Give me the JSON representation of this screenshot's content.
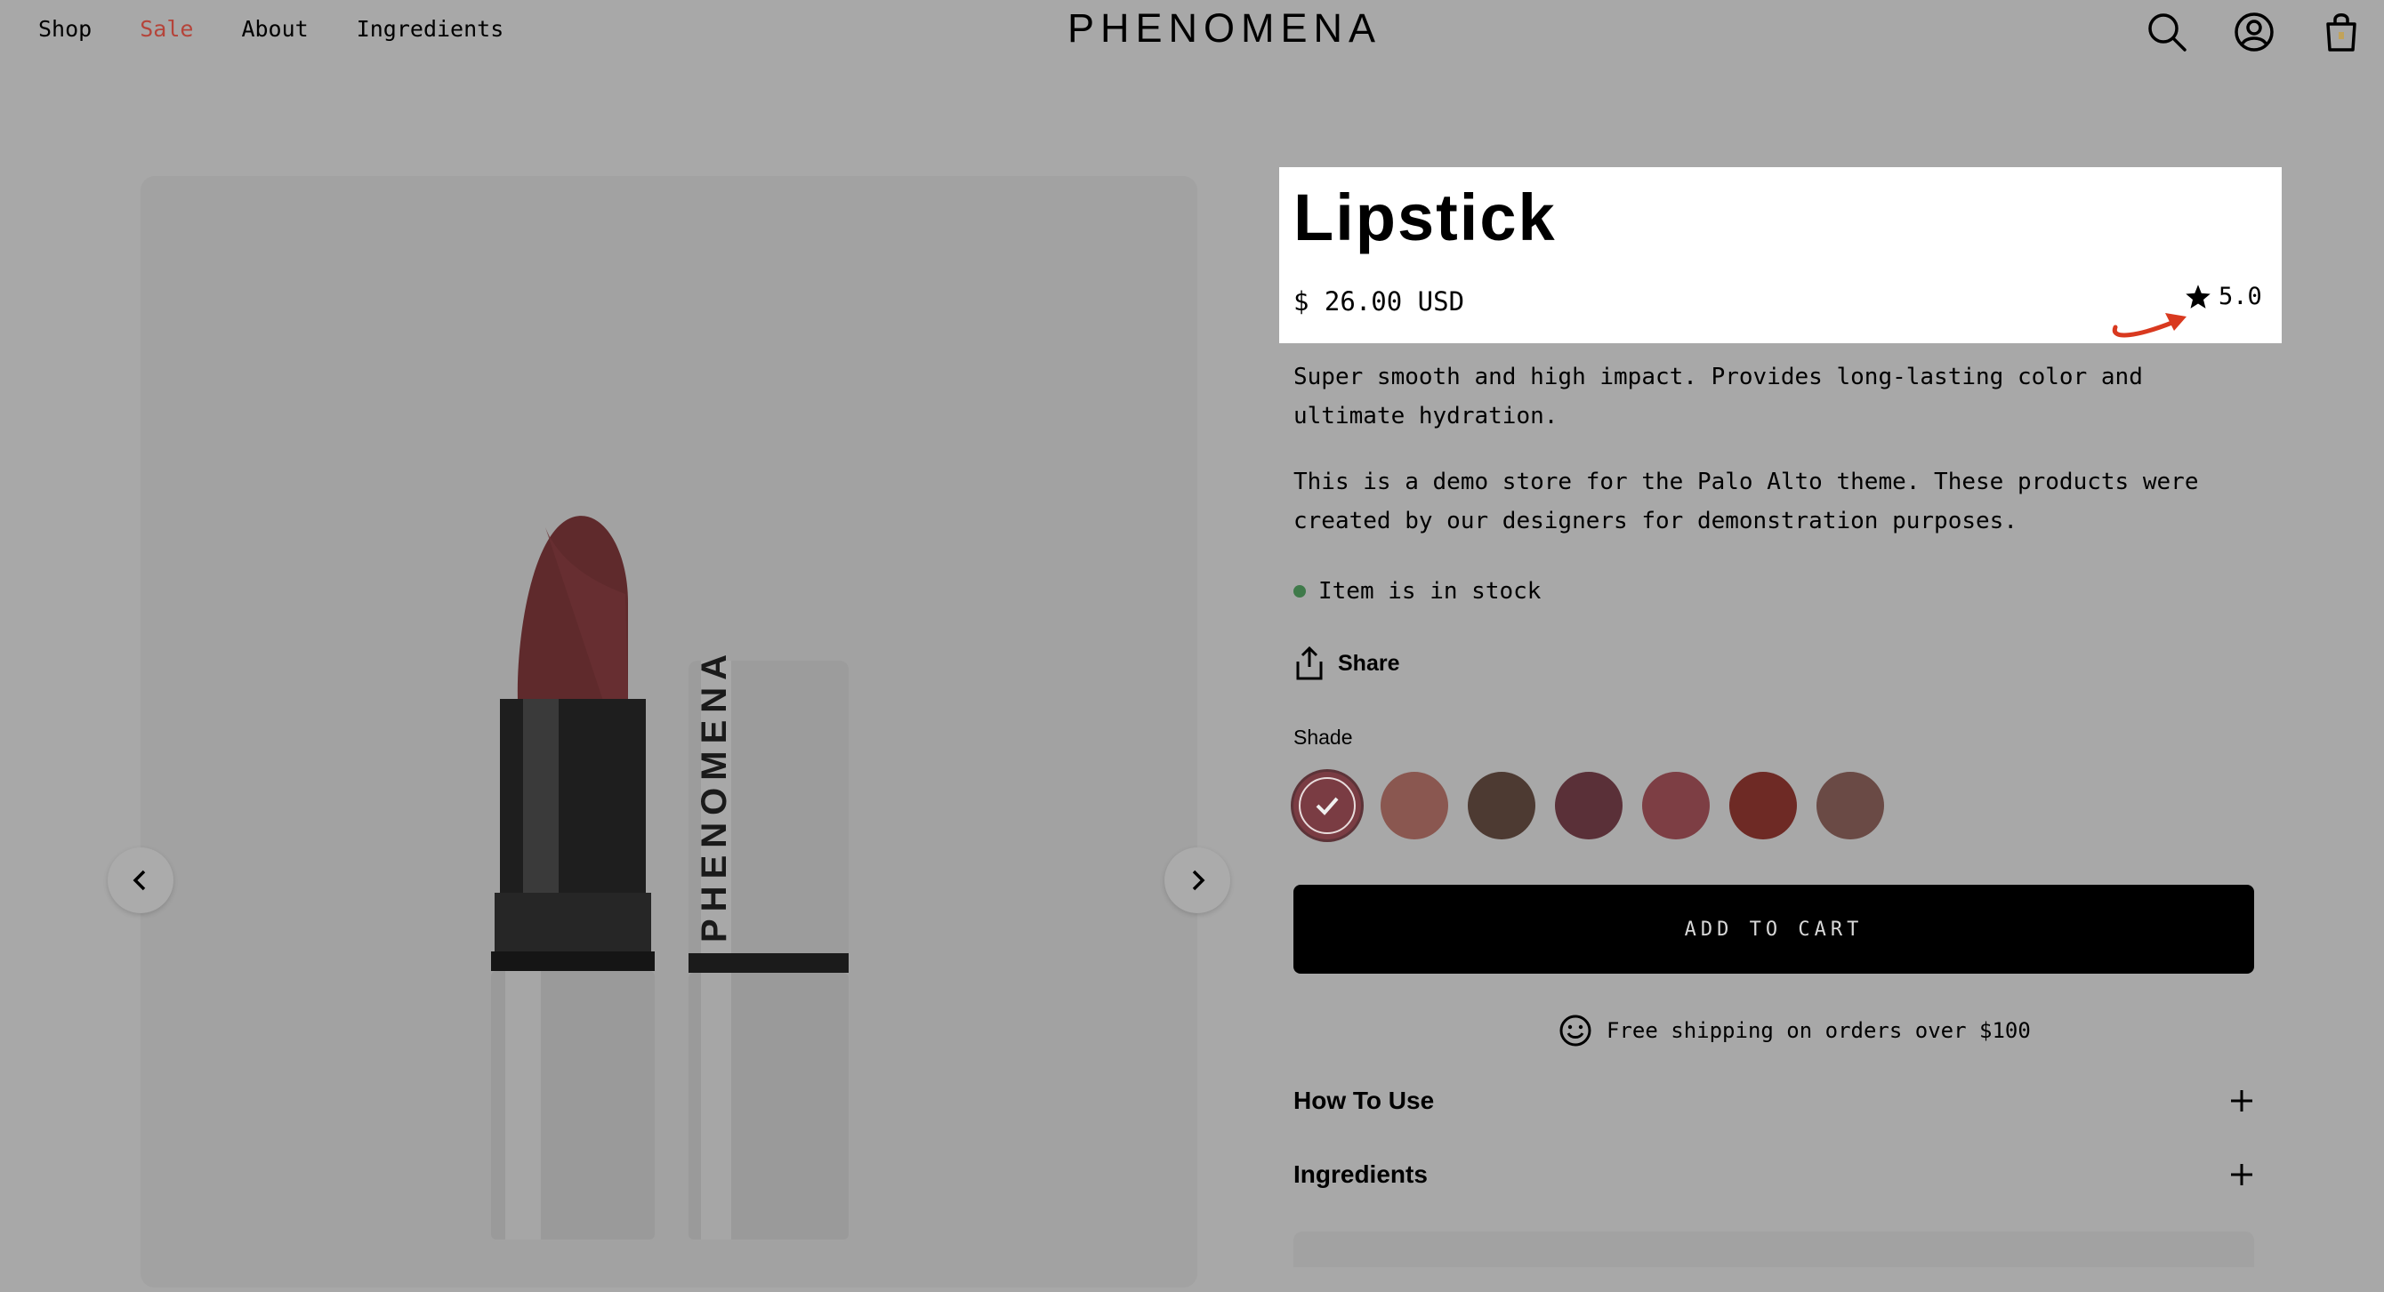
{
  "header": {
    "nav": [
      "Shop",
      "Sale",
      "About",
      "Ingredients"
    ],
    "logo": "PHENOMENA",
    "icons": [
      "search-icon",
      "account-icon",
      "cart-bag-icon"
    ]
  },
  "product": {
    "title": "Lipstick",
    "price": "$ 26.00 USD",
    "rating": "5.0",
    "description": "Super smooth and high impact. Provides long-lasting color and ultimate hydration.",
    "demo_note": "This is a demo store for the Palo Alto theme. These products were created by our designers for demonstration purposes.",
    "stock": "Item is in stock",
    "share": "Share",
    "shade_label": "Shade",
    "shades": [
      "#7a3c43",
      "#8a5750",
      "#4d3a32",
      "#5a3038",
      "#7d3e44",
      "#6e2a25",
      "#6a4a45"
    ],
    "add_to_cart": "ADD TO CART",
    "shipping": "Free shipping on orders over $100",
    "accordions": [
      "How To Use",
      "Ingredients"
    ],
    "image_brand_text": "PHENOMENA"
  },
  "colors": {
    "sale": "#b5443a",
    "annotation_arrow": "#d9391f",
    "in_stock": "#3f7a4a"
  }
}
